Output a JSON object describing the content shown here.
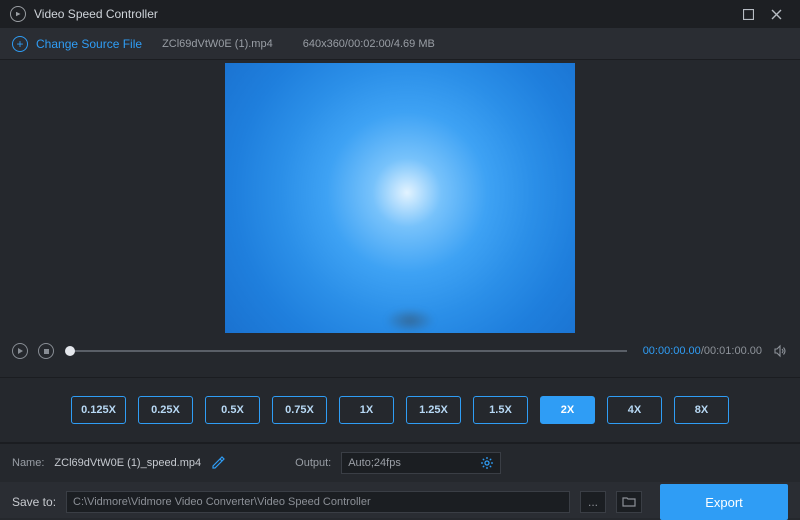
{
  "window": {
    "title": "Video Speed Controller"
  },
  "toolbar": {
    "change_source_label": "Change Source File",
    "filename": "ZCl69dVtW0E (1).mp4",
    "file_meta": "640x360/00:02:00/4.69 MB"
  },
  "playback": {
    "current_time": "00:00:00.00",
    "separator": "/",
    "duration": "00:01:00.00"
  },
  "speeds": {
    "options": [
      "0.125X",
      "0.25X",
      "0.5X",
      "0.75X",
      "1X",
      "1.25X",
      "1.5X",
      "2X",
      "4X",
      "8X"
    ],
    "active_index": 7
  },
  "name_row": {
    "label": "Name:",
    "output_filename": "ZCl69dVtW0E (1)_speed.mp4"
  },
  "output_row": {
    "label": "Output:",
    "format": "Auto;24fps"
  },
  "save_row": {
    "label": "Save to:",
    "path": "C:\\Vidmore\\Vidmore Video Converter\\Video Speed Controller",
    "more": "..."
  },
  "export": {
    "label": "Export"
  }
}
